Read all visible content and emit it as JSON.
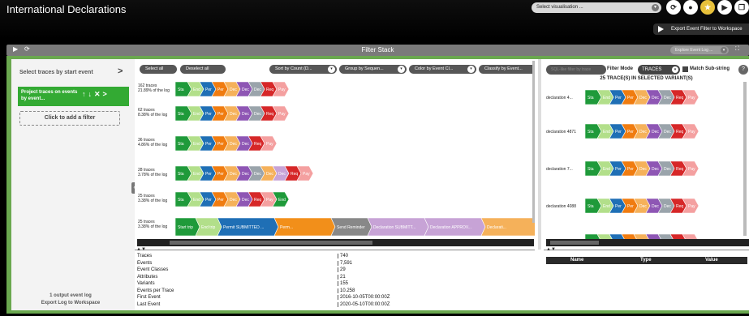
{
  "app": {
    "title": "International Declarations"
  },
  "topbar": {
    "select_vis": "Select visualisation ...",
    "export_btn": "Export Event Filter to Workspace",
    "icons": [
      "refresh-icon",
      "drop-icon",
      "star-icon",
      "play-icon",
      "copy-icon",
      "grid-icon"
    ]
  },
  "filter_stack": {
    "title": "Filter Stack",
    "explore": "Explore Event Log ..."
  },
  "left": {
    "start": "Select traces by start event",
    "project": "Project traces on events by event...",
    "add": "Click to add a filter",
    "output_count": "1 output event log",
    "export": "Export Log to Workspace"
  },
  "toolbar": {
    "select_all": "Select all",
    "deselect_all": "Deselect all",
    "sort": "Sort by Count (D...",
    "group": "Group by Sequen...",
    "color": "Color by Event Cl...",
    "classify": "Classify by Event..."
  },
  "variants": [
    {
      "count": "162 traces",
      "pct": "21.89% of the log",
      "chevrons": [
        "Sta",
        "End",
        "Per",
        "Per",
        "Dec",
        "Dec",
        "Dec",
        "Req",
        "Pay"
      ]
    },
    {
      "count": "62 traces",
      "pct": "8.38% of the log",
      "chevrons": [
        "Sta",
        "End",
        "Per",
        "Per",
        "Dec",
        "Dec",
        "Dec",
        "Req",
        "Pay"
      ]
    },
    {
      "count": "36 traces",
      "pct": "4.86% of the log",
      "chevrons": [
        "Sta",
        "End",
        "Per",
        "Per",
        "Dec",
        "Dec",
        "Req",
        "Pay"
      ]
    },
    {
      "count": "28 traces",
      "pct": "3.78% of the log",
      "chevrons": [
        "Sta",
        "End",
        "Per",
        "Per",
        "Dec",
        "Dec",
        "Dec",
        "Dec",
        "Dec",
        "Req",
        "Pay"
      ]
    },
    {
      "count": "25 traces",
      "pct": "3.38% of the log",
      "chevrons": [
        "Sta",
        "End",
        "Per",
        "Per",
        "Dec",
        "Dec",
        "Req",
        "Pay",
        "End"
      ]
    },
    {
      "count": "25 traces",
      "pct": "3.38% of the log",
      "chevrons": [
        "Start trip",
        "End trip",
        "Permit SUBMITTED ...",
        "Perm...",
        "Send Reminder",
        "Declaration SUBMITT...",
        "Declaration APPROV...",
        "Declarati..."
      ]
    }
  ],
  "stats": [
    {
      "k": "Traces",
      "v": "740"
    },
    {
      "k": "Events",
      "v": "7,591"
    },
    {
      "k": "Event Classes",
      "v": "29"
    },
    {
      "k": "Attributes",
      "v": "21"
    },
    {
      "k": "Variants",
      "v": "155"
    },
    {
      "k": "Events per Trace",
      "v": "10.258"
    },
    {
      "k": "First Event",
      "v": "2016-10-05T00:00:00Z"
    },
    {
      "k": "Last Event",
      "v": "2020-05-10T00:00:00Z"
    }
  ],
  "right": {
    "filter_placeholder": "SQL-like filter by trace",
    "mode_label": "Filter Mode",
    "mode_value": "TRACES",
    "match": "Match Sub-string",
    "count": "25 TRACE(S) IN SELECTED VARIANT(S)",
    "traces": [
      {
        "label": "declaration 4..."
      },
      {
        "label": "declaration 4871"
      },
      {
        "label": "declaration 7..."
      },
      {
        "label": "declaration 4088"
      }
    ],
    "trace_chevrons": [
      "Sta",
      "End",
      "Per",
      "Per",
      "Dec",
      "Dec",
      "Dec",
      "Req",
      "Pay"
    ],
    "cols": {
      "name": "Name",
      "type": "Type",
      "value": "Value"
    }
  },
  "colors": {
    "Sta": "#1f9a3a",
    "End": "#7ac36a",
    "Per": "#1f6fb5",
    "PerB": "#f07c10",
    "Dec": "#f5b15a",
    "DecP": "#8e56b4",
    "DecL": "#c7a3d6",
    "DecG": "#9aa4ab",
    "Req": "#d62728",
    "Pay": "#f4a0a0",
    "Send": "#888888",
    "Perm": "#f28f1a",
    "EndG": "#b2df8a"
  }
}
